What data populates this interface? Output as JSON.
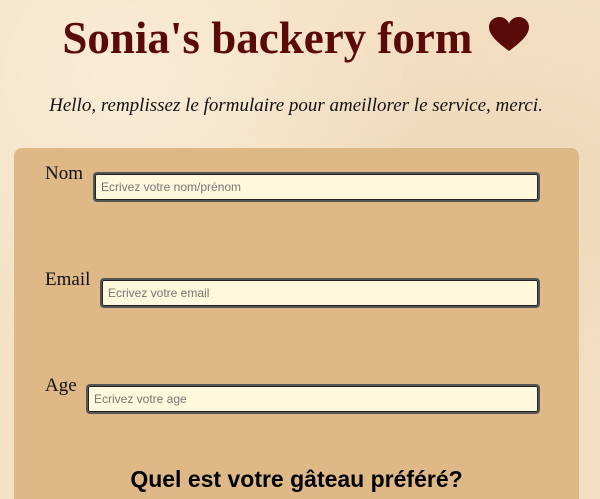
{
  "header": {
    "title": "Sonia's backery form",
    "subtitle": "Hello, remplissez le formulaire pour ameillorer le service, merci.",
    "heart_icon": "heart-icon",
    "heart_color": "#5b0a0a"
  },
  "form": {
    "fields": [
      {
        "label": "Nom",
        "placeholder": "Ecrivez votre nom/prénom"
      },
      {
        "label": "Email",
        "placeholder": "Ecrivez votre email"
      },
      {
        "label": "Age",
        "placeholder": "Ecrivez votre age"
      }
    ],
    "question": "Quel est votre gâteau préféré?"
  },
  "colors": {
    "panel": "#deb887",
    "input_background": "#fff8dc",
    "title": "#5b0a0a"
  }
}
